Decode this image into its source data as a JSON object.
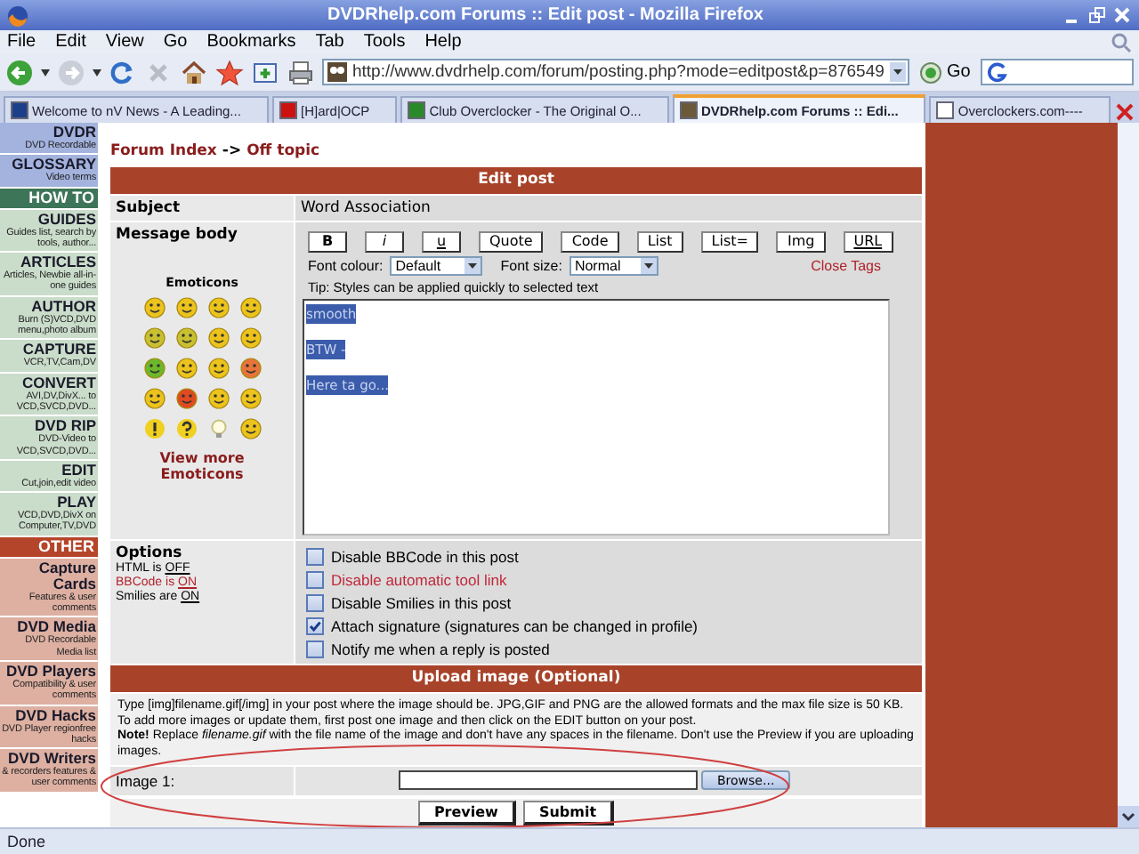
{
  "window": {
    "title": "DVDRhelp.com Forums :: Edit post - Mozilla Firefox"
  },
  "menu": [
    "File",
    "Edit",
    "View",
    "Go",
    "Bookmarks",
    "Tab",
    "Tools",
    "Help"
  ],
  "toolbar": {
    "url": "http://www.dvdrhelp.com/forum/posting.php?mode=editpost&p=876549",
    "go": "Go"
  },
  "tabs": [
    {
      "label": "Welcome to nV News - A Leading...",
      "selected": false,
      "color": "#1c3f8a"
    },
    {
      "label": "[H]ard|OCP",
      "selected": false,
      "color": "#cc1111"
    },
    {
      "label": "Club Overclocker - The Original O...",
      "selected": false,
      "color": "#2a8a2a"
    },
    {
      "label": "DVDRhelp.com Forums :: Edi...",
      "selected": true,
      "color": "#6b5a3a"
    },
    {
      "label": "Overclockers.com----",
      "selected": false,
      "color": "#ffffff"
    }
  ],
  "sidebar": [
    {
      "kind": "item",
      "title": "DVDR",
      "desc": "DVD Recordable",
      "color": "#a3b3de"
    },
    {
      "kind": "item",
      "title": "GLOSSARY",
      "desc": "Video terms",
      "color": "#a3b3de"
    },
    {
      "kind": "header",
      "title": "HOW TO",
      "color": "#3d7558"
    },
    {
      "kind": "item",
      "title": "GUIDES",
      "desc": "Guides list, search by tools, author...",
      "color": "#cadcca"
    },
    {
      "kind": "item",
      "title": "ARTICLES",
      "desc": "Articles, Newbie all-in-one guides",
      "color": "#cadcca"
    },
    {
      "kind": "item",
      "title": "AUTHOR",
      "desc": "Burn (S)VCD,DVD menu,photo album",
      "color": "#cadcca"
    },
    {
      "kind": "item",
      "title": "CAPTURE",
      "desc": "VCR,TV,Cam,DV",
      "color": "#cadcca"
    },
    {
      "kind": "item",
      "title": "CONVERT",
      "desc": "AVI,DV,DivX... to VCD,SVCD,DVD...",
      "color": "#cadcca"
    },
    {
      "kind": "item",
      "title": "DVD RIP",
      "desc": "DVD-Video to VCD,SVCD,DVD...",
      "color": "#cadcca"
    },
    {
      "kind": "item",
      "title": "EDIT",
      "desc": "Cut,join,edit video",
      "color": "#cadcca"
    },
    {
      "kind": "item",
      "title": "PLAY",
      "desc": "VCD,DVD,DivX on Computer,TV,DVD",
      "color": "#cadcca"
    },
    {
      "kind": "header",
      "title": "OTHER",
      "color": "#b5452a"
    },
    {
      "kind": "item",
      "title": "Capture Cards",
      "desc": "Features & user comments",
      "color": "#ddb0a2"
    },
    {
      "kind": "item",
      "title": "DVD Media",
      "desc": "DVD Recordable Media list",
      "color": "#ddb0a2"
    },
    {
      "kind": "item",
      "title": "DVD Players",
      "desc": "Compatibility & user comments",
      "color": "#ddb0a2"
    },
    {
      "kind": "item",
      "title": "DVD Hacks",
      "desc": "DVD Player regionfree hacks",
      "color": "#ddb0a2"
    },
    {
      "kind": "item",
      "title": "DVD Writers",
      "desc": "& recorders features & user comments",
      "color": "#ddb0a2"
    }
  ],
  "breadcrumb": {
    "links": [
      "Forum Index",
      "Off topic"
    ],
    "separator": "->"
  },
  "post": {
    "title": "Edit post",
    "subject_label": "Subject",
    "subject": "Word Association",
    "body_label": "Message body",
    "emoticons_title": "Emoticons",
    "more_emoticons": "View more Emoticons",
    "format_buttons": [
      {
        "label": "B",
        "kind": "bold"
      },
      {
        "label": "i",
        "kind": "italic"
      },
      {
        "label": "u",
        "kind": "underline"
      },
      {
        "label": "Quote",
        "kind": "plain"
      },
      {
        "label": "Code",
        "kind": "plain"
      },
      {
        "label": "List",
        "kind": "plain"
      },
      {
        "label": "List=",
        "kind": "plain"
      },
      {
        "label": "Img",
        "kind": "plain"
      },
      {
        "label": "URL",
        "kind": "underline"
      }
    ],
    "font_colour_label": "Font colour:",
    "font_colour": "Default",
    "font_size_label": "Font size:",
    "font_size": "Normal",
    "close_tags": "Close Tags",
    "tip": "Tip: Styles can be applied quickly to selected text",
    "message_lines": [
      {
        "text": "smooth",
        "selected": true
      },
      {
        "text": "BTW -",
        "selected": true
      },
      {
        "text": "Here ta go...",
        "selected": true
      }
    ]
  },
  "options": {
    "title": "Options",
    "status": [
      {
        "label": "HTML is",
        "value": "OFF",
        "color": "#000000"
      },
      {
        "label": "BBCode is",
        "value": "ON",
        "color": "#b0222a"
      },
      {
        "label": "Smilies are",
        "value": "ON",
        "color": "#000000"
      }
    ],
    "checkboxes": [
      {
        "label": "Disable BBCode in this post",
        "checked": false,
        "color": "#000000"
      },
      {
        "label": "Disable automatic tool link",
        "checked": false,
        "color": "#c0283a"
      },
      {
        "label": "Disable Smilies in this post",
        "checked": false,
        "color": "#000000"
      },
      {
        "label": "Attach signature (signatures can be changed in profile)",
        "checked": true,
        "color": "#000000"
      },
      {
        "label": "Notify me when a reply is posted",
        "checked": false,
        "color": "#000000"
      }
    ]
  },
  "upload": {
    "title": "Upload image (Optional)",
    "paragraphs": [
      "Type [img]filename.gif[/img] in your post where the image should be. JPG,GIF and PNG are the allowed formats and the max file size is 50 KB. To add more images or update them, first post one image and then click on the EDIT button on your post.",
      "**Note!** Replace *filename.gif* with the file name of the image and don't have any spaces in the filename. Don't use the Preview if you are uploading images."
    ],
    "field_label": "Image 1:",
    "browse": "Browse..."
  },
  "buttons": [
    "Preview",
    "Submit"
  ],
  "status_bar": "Done"
}
